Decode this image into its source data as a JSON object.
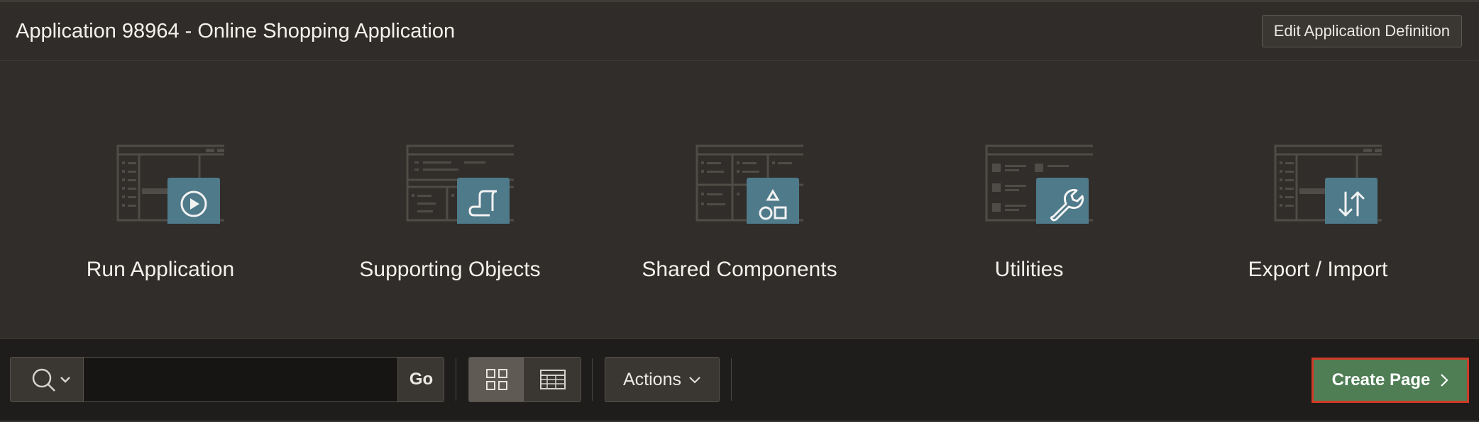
{
  "header": {
    "title": "Application 98964 - Online Shopping Application",
    "edit_button_label": "Edit Application Definition"
  },
  "tiles": [
    {
      "label": "Run Application",
      "icon": "play-icon"
    },
    {
      "label": "Supporting Objects",
      "icon": "scroll-icon"
    },
    {
      "label": "Shared Components",
      "icon": "shapes-icon"
    },
    {
      "label": "Utilities",
      "icon": "wrench-icon"
    },
    {
      "label": "Export / Import",
      "icon": "arrows-icon"
    }
  ],
  "toolbar": {
    "search": {
      "value": "",
      "placeholder": ""
    },
    "go_label": "Go",
    "view_modes": [
      {
        "name": "icons-view",
        "selected": true
      },
      {
        "name": "report-view",
        "selected": false
      }
    ],
    "actions_label": "Actions",
    "create_page_label": "Create Page"
  },
  "colors": {
    "background": "#2d2a27",
    "tile_badge": "#4f7a8a",
    "create_button": "#4f7e55",
    "create_button_outline": "#d03b26"
  }
}
